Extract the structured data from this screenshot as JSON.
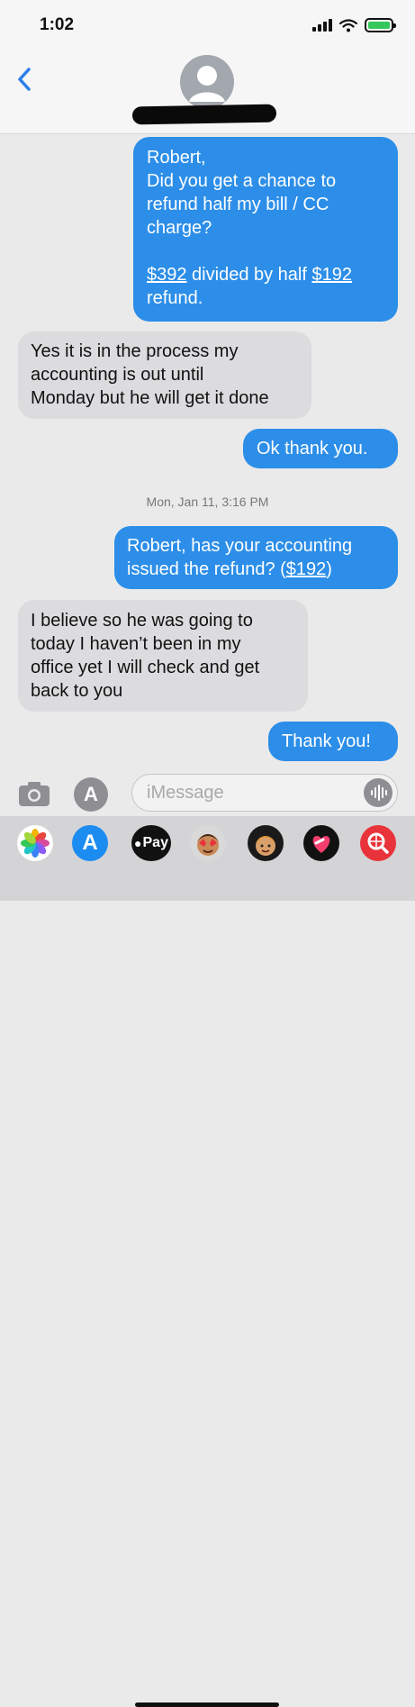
{
  "status": {
    "time": "1:02"
  },
  "messages": [
    {
      "lines": [
        "Robert,",
        "Did you get a chance to",
        "refund half my bill / CC",
        "charge?"
      ]
    },
    {
      "pre": "$392",
      "mid": " divided by half ",
      "post": "$192",
      "line2": "refund."
    },
    {
      "text": "Yes it is in the process my\naccounting is out until\nMonday but he will get it done"
    },
    {
      "text": "Ok thank you."
    },
    {
      "line1": "Robert, has your accounting",
      "line2a": "issued the refund? (",
      "amount": "$192",
      "line2b": ")"
    },
    {
      "text": "I believe so he was going to\ntoday I haven’t been in my\noffice yet I will check and get\nback to you"
    },
    {
      "text": "Thank you!"
    }
  ],
  "timestamp": "Mon, Jan 11, 3:16 PM",
  "input": {
    "placeholder": "iMessage"
  },
  "apps": {
    "applepay_label": "Pay"
  },
  "colors": {
    "outgoing": "#2c8ee8",
    "incoming": "#dcdcdf"
  },
  "icons": [
    "back-chevron-icon",
    "contact-avatar-icon",
    "camera-icon",
    "app-store-icon",
    "audio-waveform-icon",
    "photos-icon",
    "memoji-icon",
    "heart-icon",
    "search-globe-icon"
  ]
}
